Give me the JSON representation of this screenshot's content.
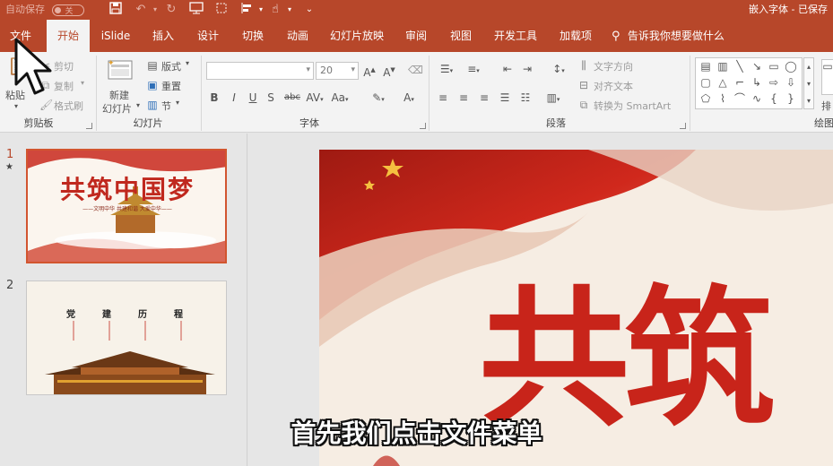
{
  "titlebar": {
    "autosave_label": "自动保存",
    "autosave_state": "关",
    "doc_title": "嵌入字体 - 已保存"
  },
  "tabs": [
    "文件",
    "开始",
    "iSlide",
    "插入",
    "设计",
    "切换",
    "动画",
    "幻灯片放映",
    "审阅",
    "视图",
    "开发工具",
    "加载项"
  ],
  "active_tab": "开始",
  "tell_me": "告诉我你想要做什么",
  "ribbon": {
    "clipboard": {
      "paste": "粘贴",
      "cut": "剪切",
      "copy": "复制",
      "format_painter": "格式刷",
      "group": "剪贴板"
    },
    "slides": {
      "new_slide_line1": "新建",
      "new_slide_line2": "幻灯片",
      "layout": "版式",
      "reset": "重置",
      "section": "节",
      "group": "幻灯片"
    },
    "font": {
      "font_name": "",
      "font_size": "20",
      "group": "字体"
    },
    "paragraph": {
      "text_direction": "文字方向",
      "align_text": "对齐文本",
      "convert_smartart": "转换为 SmartArt",
      "group": "段落"
    },
    "drawing": {
      "group": "绘图",
      "arrange": "排"
    }
  },
  "slides": [
    {
      "number": "1",
      "title": "共筑中国梦",
      "subtitle": "——文明中华 共建和谐 大爱中华——"
    },
    {
      "number": "2",
      "items": [
        "党",
        "建",
        "历",
        "程"
      ]
    }
  ],
  "canvas": {
    "title_chars": "共筑"
  },
  "caption": "首先我们点击文件菜单",
  "colors": {
    "accent": "#b7472a",
    "slide_red": "#c0281e",
    "ribbon_bg": "#f3f3f3"
  }
}
